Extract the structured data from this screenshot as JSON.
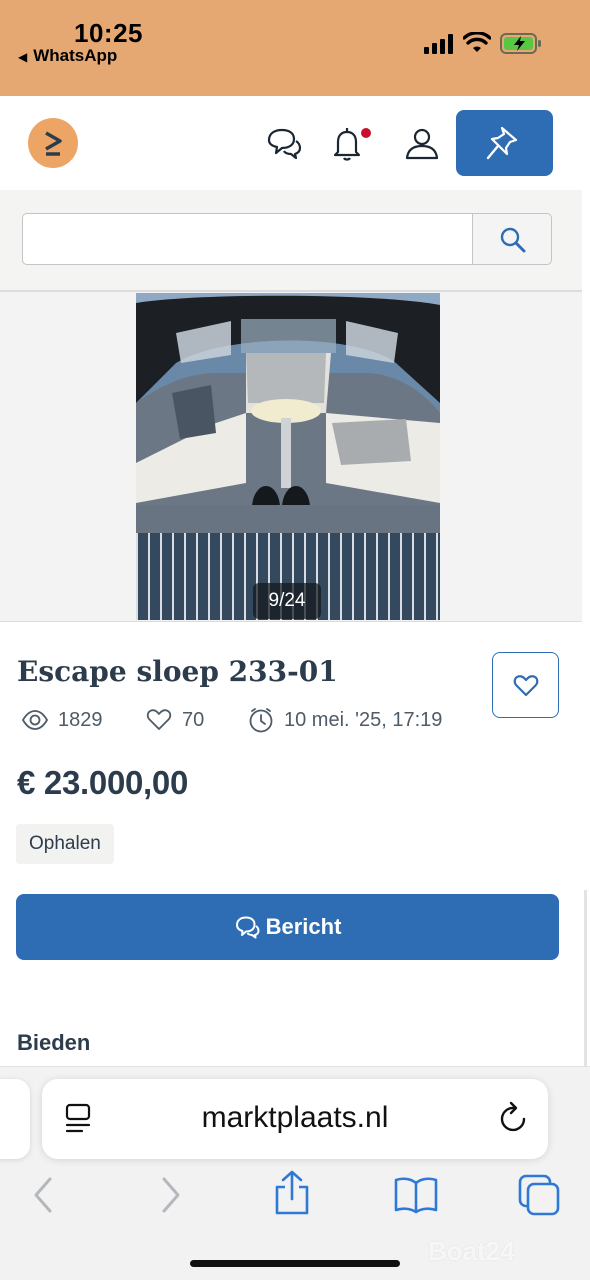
{
  "status_bar": {
    "time": "10:25",
    "back_app": "WhatsApp",
    "back_arrow": "◀"
  },
  "header": {
    "logo_icon": "marktplaats-logo-icon",
    "icons": [
      "chat-icon",
      "bell-icon",
      "user-icon",
      "pin-icon"
    ],
    "notification_dot": true,
    "accent_color": "#2e6db4"
  },
  "search": {
    "value": "",
    "placeholder": "",
    "icon": "search-icon"
  },
  "gallery": {
    "counter": "9/24",
    "current": 9,
    "total": 24
  },
  "listing": {
    "title": "Escape sloep 233-01",
    "views": "1829",
    "favorites": "70",
    "posted": "10 mei. '25, 17:19",
    "price": "€ 23.000,00",
    "delivery": "Ophalen",
    "message_button": "Bericht",
    "bid_heading": "Bieden"
  },
  "browser": {
    "url": "marktplaats.nl",
    "icons": [
      "page-menu-icon",
      "reload-icon",
      "back-icon",
      "forward-icon",
      "share-icon",
      "bookmarks-icon",
      "tabs-icon"
    ],
    "tint": "#2e78d6"
  },
  "watermark": "Boat24"
}
